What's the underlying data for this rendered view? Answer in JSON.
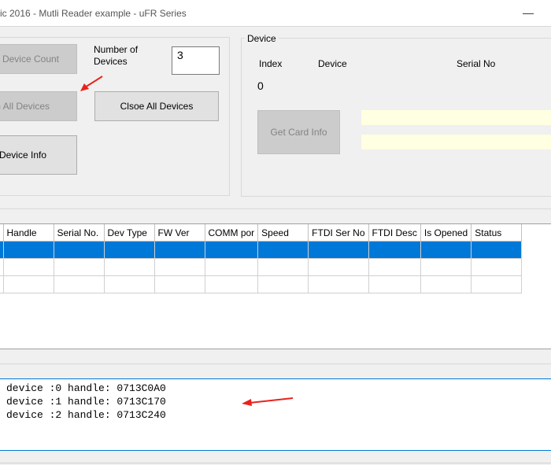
{
  "window": {
    "title": "ic 2016 - Mutli Reader example - uFR Series",
    "minimize_icon": "—"
  },
  "controls": {
    "device_count_label": "Device Count",
    "number_of_devices_label": "Number of\nDevices",
    "number_of_devices_value": "3",
    "open_all_label": "n All Devices",
    "close_all_label": "Clsoe All Devices",
    "device_info_label": "Device Info"
  },
  "device_group": {
    "legend": "Device",
    "col_index": "Index",
    "col_device": "Device",
    "col_serial": "Serial No",
    "index_value": "0",
    "get_card_info_label": "Get Card Info"
  },
  "grid": {
    "columns": [
      "Handle",
      "Serial No.",
      "Dev Type",
      "FW Ver",
      "COMM por",
      "Speed",
      "FTDI Ser No",
      "FTDI Desc",
      "Is Opened",
      "Status"
    ],
    "row_count": 3,
    "selected_row": 0
  },
  "log": {
    "lines": [
      "device :0 handle: 0713C0A0",
      "device :1 handle: 0713C170",
      "device :2 handle: 0713C240"
    ]
  },
  "colors": {
    "selection": "#0078d7",
    "arrow": "#e8231c",
    "highlight_field": "#ffffe1"
  }
}
